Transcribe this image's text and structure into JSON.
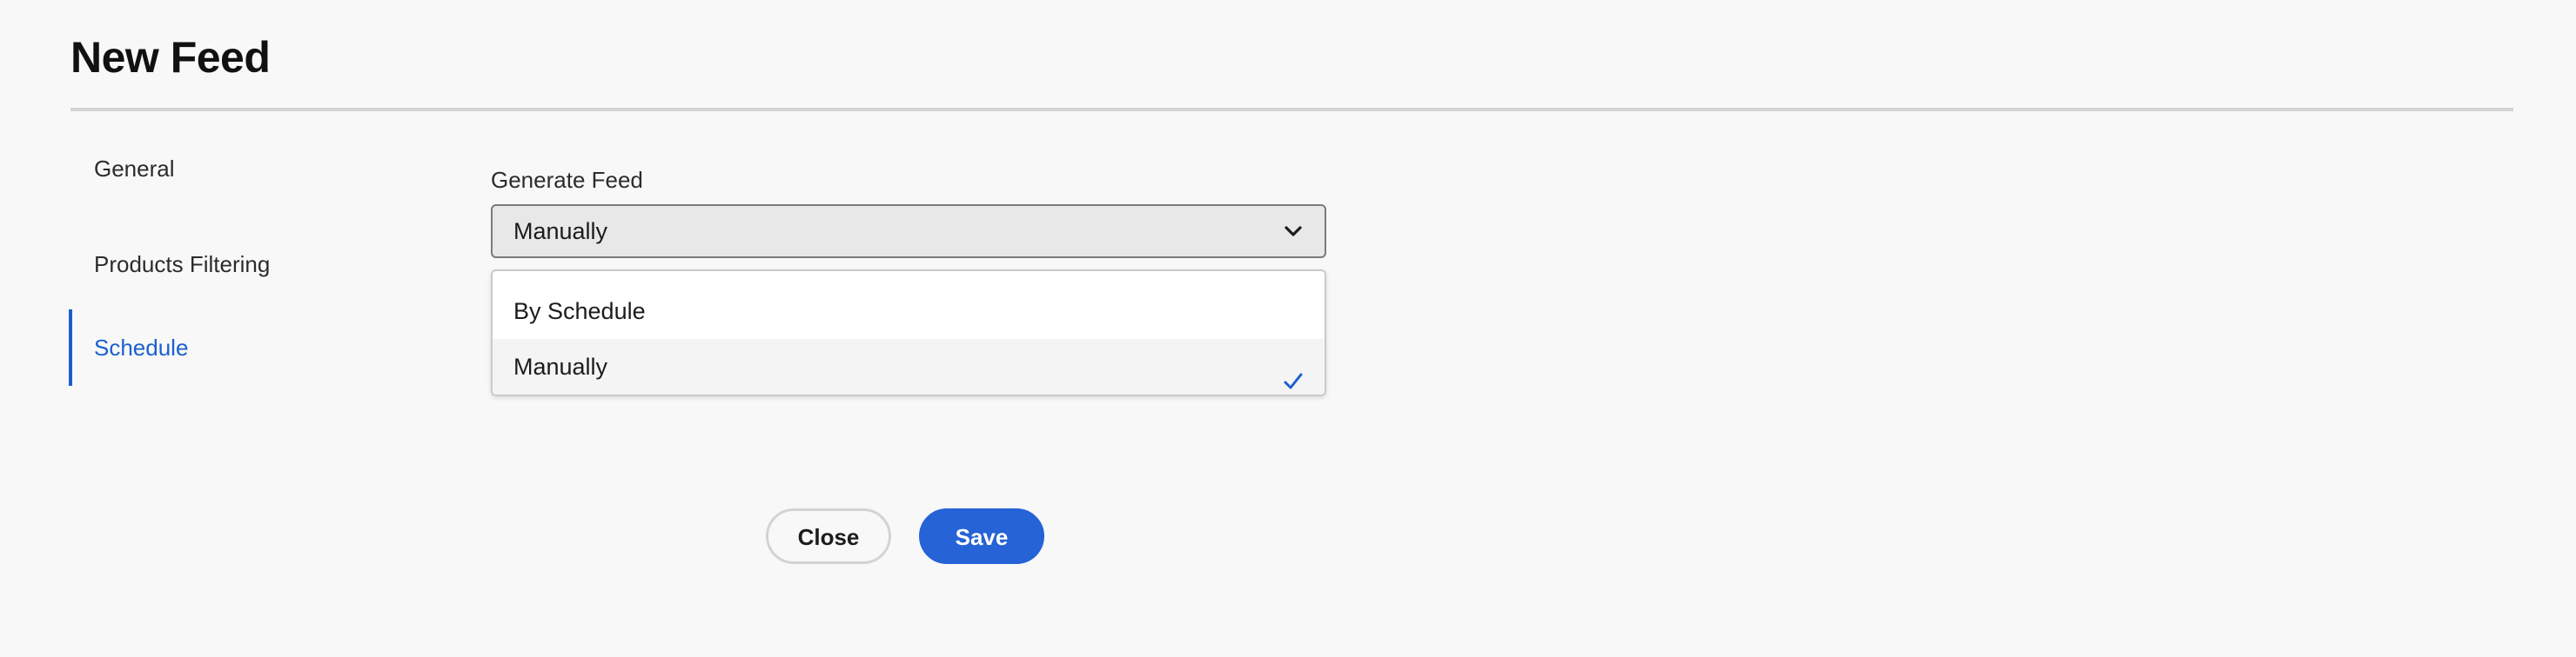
{
  "page": {
    "title": "New Feed"
  },
  "sidebar": {
    "items": [
      {
        "label": "General",
        "active": false
      },
      {
        "label": "Products Filtering",
        "active": false
      },
      {
        "label": "Schedule",
        "active": true
      }
    ]
  },
  "generate_feed": {
    "label": "Generate Feed",
    "value": "Manually",
    "icon": "chevron-down-icon",
    "options": [
      {
        "label": "By Schedule",
        "selected": false
      },
      {
        "label": "Manually",
        "selected": true,
        "icon": "checkmark-icon"
      }
    ]
  },
  "actions": {
    "close_label": "Close",
    "save_label": "Save"
  },
  "colors": {
    "accent": "#1a5fcf",
    "primary_button": "#2563d6",
    "background": "#f8f8f8"
  }
}
